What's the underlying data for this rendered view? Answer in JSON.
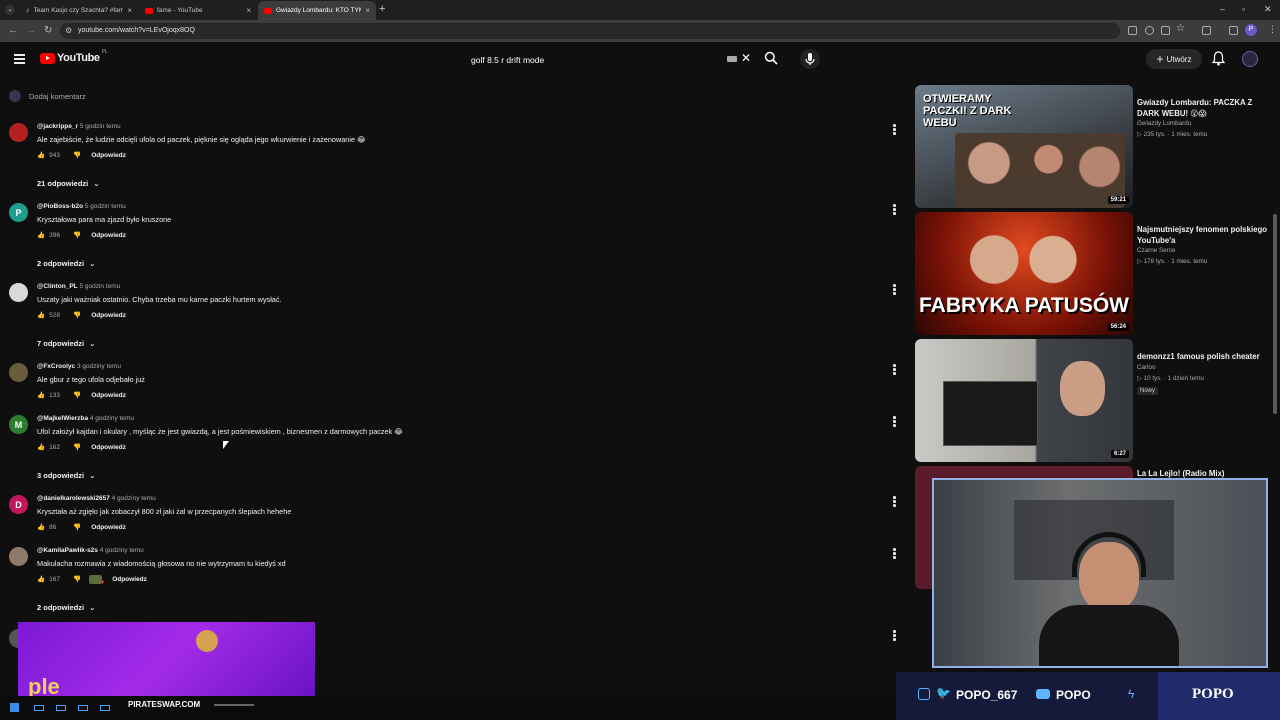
{
  "browser": {
    "tabs": [
      {
        "title": "Team Kasjo czy Szachta? #fame",
        "active": false
      },
      {
        "title": "fame - YouTube",
        "active": false
      },
      {
        "title": "Gwiazdy Lombardu: KTO TYM Ł",
        "active": true
      }
    ],
    "url": "youtube.com/watch?v=LEvOjoqx8OQ"
  },
  "youtube": {
    "logo_text": "YouTube",
    "region": "PL",
    "search_value": "golf 8.5 r drift mode",
    "create_label": "Utwórz"
  },
  "comments": {
    "add_comment": "Dodaj komentarz",
    "reply_label": "Odpowiedz",
    "items": [
      {
        "author": "@jackrippe_r",
        "time": "5 godzin temu",
        "text": "Ale zajebiście, że ludzie odcięli ufola od paczek, pięknie się ogląda jego wkurwienie i zażenowanie 😂",
        "likes": "943",
        "replies": "21 odpowiedzi",
        "avatar_color": "#b3221f",
        "avatar_letter": ""
      },
      {
        "author": "@PioBoss-b2o",
        "time": "5 godzin temu",
        "text": "Kryształowa para ma zjazd było kruszone",
        "likes": "396",
        "replies": "2 odpowiedzi",
        "avatar_color": "#1e9e8f",
        "avatar_letter": "P"
      },
      {
        "author": "@Clinton_PL",
        "time": "5 godzin temu",
        "text": "Uszaty jaki ważniak ostatnio. Chyba trzeba mu karne paczki hurtem wysłać.",
        "likes": "528",
        "replies": "7 odpowiedzi",
        "avatar_color": "#d9d9d9",
        "avatar_letter": ""
      },
      {
        "author": "@FxCroolyc",
        "time": "3 godziny temu",
        "text": "Ale gbur z tego ufola odjebało już",
        "likes": "133",
        "replies": "",
        "avatar_color": "#6a5d3e",
        "avatar_letter": ""
      },
      {
        "author": "@MajkelWierzba",
        "time": "4 godziny temu",
        "text": "Ufol założył kajdan i okulary , myśląc że jest gwiazdą, a jest pośmiewiskiem , biznesmen z darmowych paczek 😂",
        "likes": "162",
        "replies": "3 odpowiedzi",
        "avatar_color": "#2f7d32",
        "avatar_letter": "M"
      },
      {
        "author": "@danielkarolewski2657",
        "time": "4 godziny temu",
        "text": "Kryształa aż zgięło jak zobaczył 800 zł jaki żal w przecpanych  ślepiach hehehe",
        "likes": "86",
        "replies": "",
        "avatar_color": "#c2185b",
        "avatar_letter": "D"
      },
      {
        "author": "@KamilaPawlik-s2s",
        "time": "4 godziny temu",
        "text": "Makulacha rozmawia z wiadomością głosowa no nie wytrzymam tu kiedyś xd",
        "likes": "167",
        "replies": "2 odpowiedzi",
        "avatar_color": "#8d7a6b",
        "avatar_letter": ""
      }
    ]
  },
  "related": [
    {
      "title": "Gwiazdy Lombardu: PACZKA Z DARK WEBU! 😲😱",
      "channel": "Gwiazdy Lombardu",
      "views": "235 tys.",
      "age": "1 mies. temu",
      "duration": "59:21",
      "thumb_text": "OTWIERAMY PACZKI! Z DARK WEBU"
    },
    {
      "title": "Najsmutniejszy fenomen polskiego YouTube'a",
      "channel": "Czarne Serce",
      "views": "178 tys.",
      "age": "1 mies. temu",
      "duration": "56:24",
      "thumb_text": "FABRYKA PATUSÓW"
    },
    {
      "title": "demonzz1 famous polish cheater",
      "channel": "Carloo",
      "views": "10 tys.",
      "age": "1 dzień temu",
      "duration": "6:27",
      "badge": "Nowy"
    },
    {
      "title": "La La Lejlo! (Radio Mix)"
    }
  ],
  "overlay": {
    "handle": "POPO_667",
    "yt_name": "POPO",
    "brand": "POPO",
    "ad_text": "PIRATESWAP.COM"
  }
}
